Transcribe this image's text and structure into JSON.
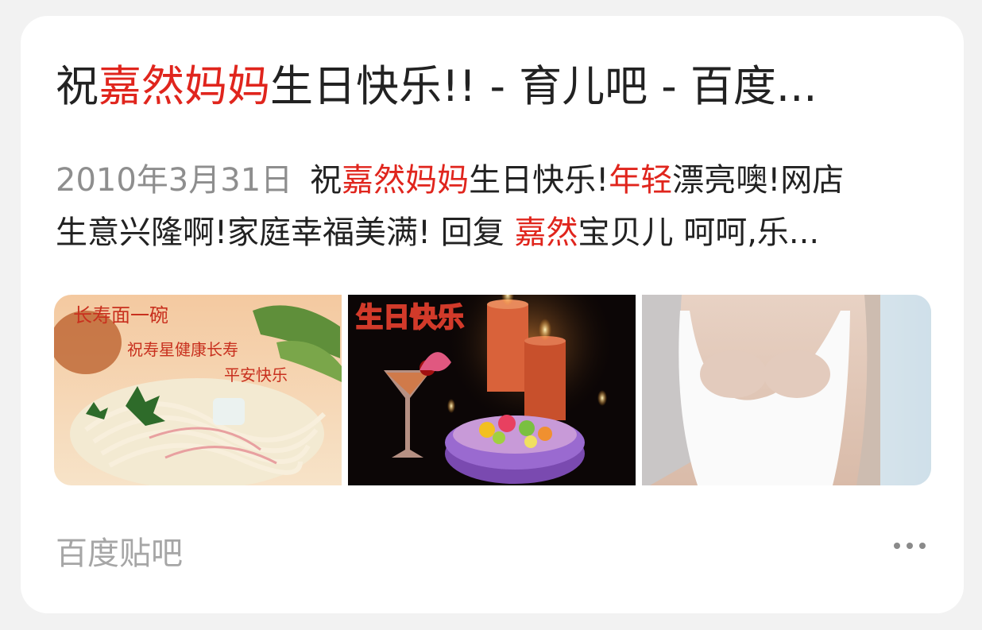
{
  "result": {
    "title": {
      "pre": "祝",
      "highlight": "嘉然妈妈",
      "post": "生日快乐!! - 育儿吧 - 百度..."
    },
    "snippet": {
      "date": "2010年3月31日",
      "line1": [
        {
          "text": "祝",
          "hl": false
        },
        {
          "text": "嘉然妈妈",
          "hl": true
        },
        {
          "text": "生日快乐!",
          "hl": false
        },
        {
          "text": "年轻",
          "hl": true
        },
        {
          "text": "漂亮噢!网店",
          "hl": false
        }
      ],
      "line2": [
        {
          "text": "生意兴隆啊!家庭幸福美满! 回复 ",
          "hl": false
        },
        {
          "text": "嘉然",
          "hl": true
        },
        {
          "text": "宝贝儿 呵呵,乐...",
          "hl": false
        }
      ]
    },
    "images": [
      {
        "name": "noodle-image",
        "caption_line1": "长寿面一碗",
        "caption_line2": "祝寿星健康长寿",
        "caption_line3": "平安快乐"
      },
      {
        "name": "birthday-cake-image",
        "caption": "生日快乐"
      },
      {
        "name": "woman-photo-image"
      }
    ],
    "source": "百度贴吧",
    "more_icon": "more-dots-icon"
  },
  "colors": {
    "highlight": "#e0251d",
    "text": "#222222",
    "muted": "#8e8e8e"
  }
}
